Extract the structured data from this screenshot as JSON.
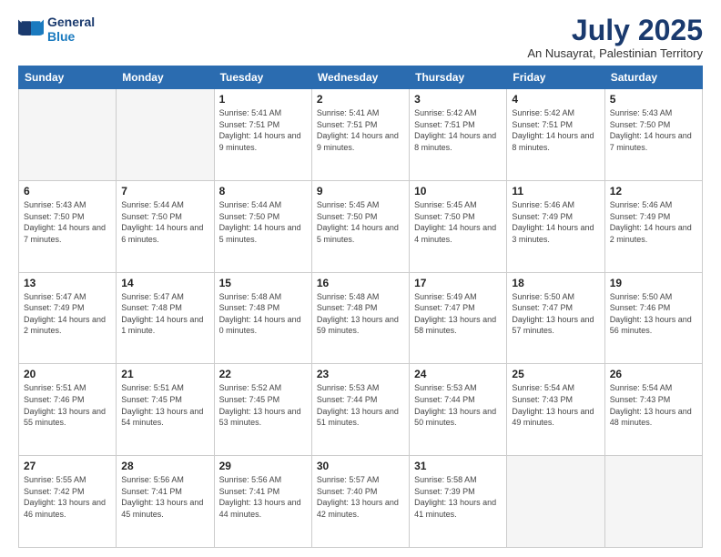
{
  "logo": {
    "line1": "General",
    "line2": "Blue"
  },
  "title": "July 2025",
  "subtitle": "An Nusayrat, Palestinian Territory",
  "days_header": [
    "Sunday",
    "Monday",
    "Tuesday",
    "Wednesday",
    "Thursday",
    "Friday",
    "Saturday"
  ],
  "weeks": [
    [
      {
        "day": "",
        "info": ""
      },
      {
        "day": "",
        "info": ""
      },
      {
        "day": "1",
        "info": "Sunrise: 5:41 AM\nSunset: 7:51 PM\nDaylight: 14 hours and 9 minutes."
      },
      {
        "day": "2",
        "info": "Sunrise: 5:41 AM\nSunset: 7:51 PM\nDaylight: 14 hours and 9 minutes."
      },
      {
        "day": "3",
        "info": "Sunrise: 5:42 AM\nSunset: 7:51 PM\nDaylight: 14 hours and 8 minutes."
      },
      {
        "day": "4",
        "info": "Sunrise: 5:42 AM\nSunset: 7:51 PM\nDaylight: 14 hours and 8 minutes."
      },
      {
        "day": "5",
        "info": "Sunrise: 5:43 AM\nSunset: 7:50 PM\nDaylight: 14 hours and 7 minutes."
      }
    ],
    [
      {
        "day": "6",
        "info": "Sunrise: 5:43 AM\nSunset: 7:50 PM\nDaylight: 14 hours and 7 minutes."
      },
      {
        "day": "7",
        "info": "Sunrise: 5:44 AM\nSunset: 7:50 PM\nDaylight: 14 hours and 6 minutes."
      },
      {
        "day": "8",
        "info": "Sunrise: 5:44 AM\nSunset: 7:50 PM\nDaylight: 14 hours and 5 minutes."
      },
      {
        "day": "9",
        "info": "Sunrise: 5:45 AM\nSunset: 7:50 PM\nDaylight: 14 hours and 5 minutes."
      },
      {
        "day": "10",
        "info": "Sunrise: 5:45 AM\nSunset: 7:50 PM\nDaylight: 14 hours and 4 minutes."
      },
      {
        "day": "11",
        "info": "Sunrise: 5:46 AM\nSunset: 7:49 PM\nDaylight: 14 hours and 3 minutes."
      },
      {
        "day": "12",
        "info": "Sunrise: 5:46 AM\nSunset: 7:49 PM\nDaylight: 14 hours and 2 minutes."
      }
    ],
    [
      {
        "day": "13",
        "info": "Sunrise: 5:47 AM\nSunset: 7:49 PM\nDaylight: 14 hours and 2 minutes."
      },
      {
        "day": "14",
        "info": "Sunrise: 5:47 AM\nSunset: 7:48 PM\nDaylight: 14 hours and 1 minute."
      },
      {
        "day": "15",
        "info": "Sunrise: 5:48 AM\nSunset: 7:48 PM\nDaylight: 14 hours and 0 minutes."
      },
      {
        "day": "16",
        "info": "Sunrise: 5:48 AM\nSunset: 7:48 PM\nDaylight: 13 hours and 59 minutes."
      },
      {
        "day": "17",
        "info": "Sunrise: 5:49 AM\nSunset: 7:47 PM\nDaylight: 13 hours and 58 minutes."
      },
      {
        "day": "18",
        "info": "Sunrise: 5:50 AM\nSunset: 7:47 PM\nDaylight: 13 hours and 57 minutes."
      },
      {
        "day": "19",
        "info": "Sunrise: 5:50 AM\nSunset: 7:46 PM\nDaylight: 13 hours and 56 minutes."
      }
    ],
    [
      {
        "day": "20",
        "info": "Sunrise: 5:51 AM\nSunset: 7:46 PM\nDaylight: 13 hours and 55 minutes."
      },
      {
        "day": "21",
        "info": "Sunrise: 5:51 AM\nSunset: 7:45 PM\nDaylight: 13 hours and 54 minutes."
      },
      {
        "day": "22",
        "info": "Sunrise: 5:52 AM\nSunset: 7:45 PM\nDaylight: 13 hours and 53 minutes."
      },
      {
        "day": "23",
        "info": "Sunrise: 5:53 AM\nSunset: 7:44 PM\nDaylight: 13 hours and 51 minutes."
      },
      {
        "day": "24",
        "info": "Sunrise: 5:53 AM\nSunset: 7:44 PM\nDaylight: 13 hours and 50 minutes."
      },
      {
        "day": "25",
        "info": "Sunrise: 5:54 AM\nSunset: 7:43 PM\nDaylight: 13 hours and 49 minutes."
      },
      {
        "day": "26",
        "info": "Sunrise: 5:54 AM\nSunset: 7:43 PM\nDaylight: 13 hours and 48 minutes."
      }
    ],
    [
      {
        "day": "27",
        "info": "Sunrise: 5:55 AM\nSunset: 7:42 PM\nDaylight: 13 hours and 46 minutes."
      },
      {
        "day": "28",
        "info": "Sunrise: 5:56 AM\nSunset: 7:41 PM\nDaylight: 13 hours and 45 minutes."
      },
      {
        "day": "29",
        "info": "Sunrise: 5:56 AM\nSunset: 7:41 PM\nDaylight: 13 hours and 44 minutes."
      },
      {
        "day": "30",
        "info": "Sunrise: 5:57 AM\nSunset: 7:40 PM\nDaylight: 13 hours and 42 minutes."
      },
      {
        "day": "31",
        "info": "Sunrise: 5:58 AM\nSunset: 7:39 PM\nDaylight: 13 hours and 41 minutes."
      },
      {
        "day": "",
        "info": ""
      },
      {
        "day": "",
        "info": ""
      }
    ]
  ]
}
